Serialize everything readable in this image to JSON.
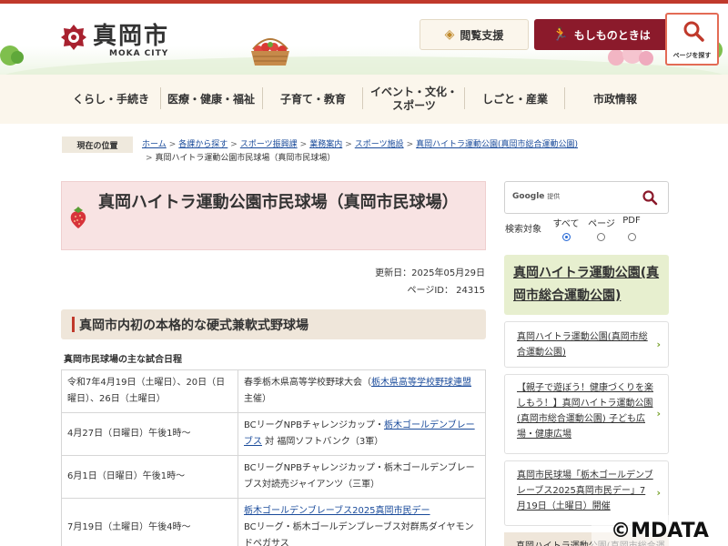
{
  "header": {
    "city_name": "真岡市",
    "city_name_en": "MOKA CITY",
    "support_button": "閲覧支援",
    "emergency_button": "もしものときは",
    "search_button": "ページを探す"
  },
  "gnav": {
    "items": [
      {
        "label": "くらし・手続き"
      },
      {
        "label": "医療・健康・福祉"
      },
      {
        "label": "子育て・教育"
      },
      {
        "label": "イベント・文化・\nスポーツ"
      },
      {
        "label": "しごと・産業"
      },
      {
        "label": "市政情報"
      }
    ]
  },
  "breadcrumb": {
    "label": "現在の位置",
    "items": [
      {
        "label": "ホーム"
      },
      {
        "label": "各課から探す"
      },
      {
        "label": "スポーツ振興課"
      },
      {
        "label": "業務案内"
      },
      {
        "label": "スポーツ施設"
      },
      {
        "label": "真岡ハイトラ運動公園(真岡市総合運動公園)"
      }
    ],
    "current": "真岡ハイトラ運動公園市民球場（真岡市民球場）"
  },
  "page": {
    "title": "真岡ハイトラ運動公園市民球場（真岡市民球場）",
    "updated": "更新日：2025年05月29日",
    "page_id": "ページID： 24315",
    "section_heading": "真岡市内初の本格的な硬式兼軟式野球場",
    "schedule_caption": "真岡市民球場の主な試合日程"
  },
  "schedule": [
    {
      "date": "令和7年4月19日（土曜日）、20日（日曜日）、26日（土曜日）",
      "event_pre": "春季栃木県高等学校野球大会（",
      "event_link": "栃木県高等学校野球連盟",
      "event_post": "主催）"
    },
    {
      "date": "4月27日（日曜日）午後1時～",
      "event_pre": "BCリーグNPBチャレンジカップ・",
      "event_link": "栃木ゴールデンブレーブス",
      "event_post": " 対 福岡ソフトバンク（3軍）"
    },
    {
      "date": "6月1日（日曜日）午後1時～",
      "event_pre": "BCリーグNPBチャレンジカップ・栃木ゴールデンブレーブス対読売ジャイアンツ（三軍）",
      "event_link": "",
      "event_post": ""
    },
    {
      "date": "7月19日（土曜日）午後4時～",
      "event_pre": "",
      "event_link": "栃木ゴールデンブレーブス2025真岡市民デー",
      "event_post": "BCリーグ・栃木ゴールデンブレーブス対群馬ダイヤモンドペガサス"
    }
  ],
  "sidebar": {
    "google_label": "Google",
    "google_sub": "提供",
    "scope_label": "検索対象",
    "scope_options": [
      "すべて",
      "ページ",
      "PDF"
    ],
    "scope_selected": "すべて",
    "category_title": "真岡ハイトラ運動公園(真岡市総合運動公園)",
    "links": [
      {
        "label": "真岡ハイトラ運動公園(真岡市総合運動公園)"
      },
      {
        "label": "【親子で遊ぼう！健康づくりを楽しもう！】真岡ハイトラ運動公園(真岡市総合運動公園) 子ども広場・健康広場"
      },
      {
        "label": "真岡市民球場「栃木ゴールデンブレーブス2025真岡市民デー」7月19日（土曜日）開催"
      }
    ],
    "next_peek": "真岡ハイトラ運動公園(真岡市総合運"
  },
  "watermark": "©MDATA",
  "colors": {
    "brand_red": "#c0392b",
    "emergency": "#8b1a2b",
    "nav_bg": "#fbf6ec",
    "title_bg": "#f8e3e3",
    "side_head_bg": "#e7efcf",
    "link": "#1a4b9b"
  }
}
